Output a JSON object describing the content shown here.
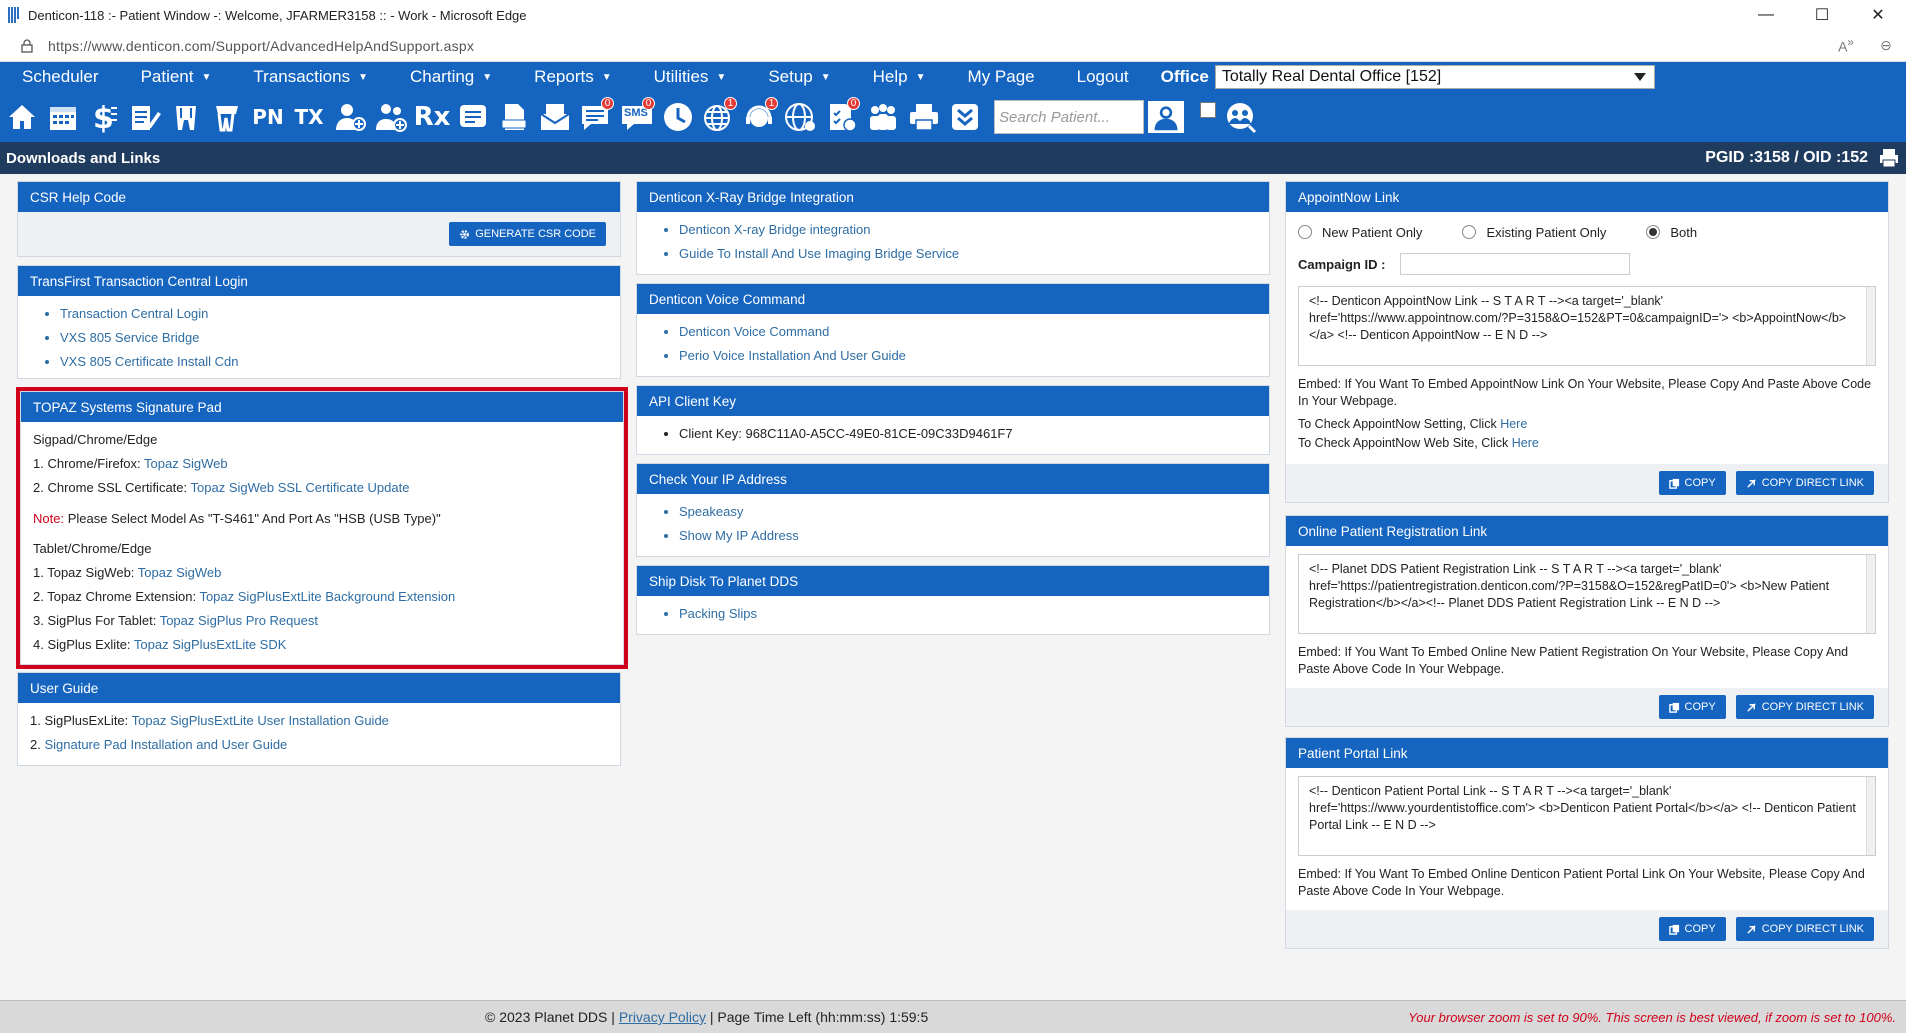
{
  "window": {
    "title": "Denticon-118 :- Patient Window -: Welcome, JFARMER3158 :: - Work - Microsoft Edge",
    "url": "https://www.denticon.com/Support/AdvancedHelpAndSupport.aspx"
  },
  "nav": {
    "items": [
      "Scheduler",
      "Patient",
      "Transactions",
      "Charting",
      "Reports",
      "Utilities",
      "Setup",
      "Help",
      "My Page",
      "Logout"
    ],
    "office_label": "Office",
    "office_value": "Totally Real Dental Office [152]"
  },
  "toolbar": {
    "pn_label": "PN",
    "tx_label": "TX",
    "rx_label": "Rx",
    "sms_label": "SMS",
    "badges": {
      "sms": "0",
      "globe": "1",
      "chat": "0",
      "help": "1",
      "doc": "0"
    },
    "search_placeholder": "Search Patient..."
  },
  "header": {
    "title": "Downloads and Links",
    "ids": "PGID :3158  /  OID :152"
  },
  "csr": {
    "title": "CSR Help Code",
    "button": "GENERATE CSR CODE"
  },
  "transfirst": {
    "title": "TransFirst Transaction Central Login",
    "links": [
      "Transaction Central Login",
      "VXS 805 Service Bridge",
      "VXS 805 Certificate Install Cdn"
    ]
  },
  "topaz": {
    "title": "TOPAZ Systems Signature Pad",
    "section1": "Sigpad/Chrome/Edge",
    "l1_label": "1. Chrome/Firefox: ",
    "l1_link": "Topaz SigWeb",
    "l2_label": "2. Chrome SSL Certificate: ",
    "l2_link": "Topaz SigWeb SSL Certificate Update",
    "note_label": "Note:",
    "note_text": " Please Select Model As \"T-S461\" And Port As \"HSB (USB Type)\"",
    "section2": "Tablet/Chrome/Edge",
    "t1_label": "1. Topaz SigWeb: ",
    "t1_link": "Topaz SigWeb",
    "t2_label": "2. Topaz Chrome Extension: ",
    "t2_link": "Topaz SigPlusExtLite Background Extension",
    "t3_label": "3. SigPlus For Tablet: ",
    "t3_link": "Topaz SigPlus Pro Request",
    "t4_label": "4. SigPlus Exlite: ",
    "t4_link": "Topaz SigPlusExtLite SDK"
  },
  "userguide": {
    "title": "User Guide",
    "g1_label": "1. SigPlusExLite: ",
    "g1_link": "Topaz SigPlusExtLite User Installation Guide",
    "g2_label": "2. ",
    "g2_link": "Signature Pad Installation and User Guide"
  },
  "xray": {
    "title": "Denticon X-Ray Bridge Integration",
    "links": [
      "Denticon X-ray Bridge integration",
      "Guide To Install And Use Imaging Bridge Service"
    ]
  },
  "voice": {
    "title": "Denticon Voice Command",
    "links": [
      "Denticon Voice Command",
      "Perio Voice Installation And User Guide"
    ]
  },
  "api": {
    "title": "API Client Key",
    "item": "Client Key: 968C11A0-A5CC-49E0-81CE-09C33D9461F7"
  },
  "ip": {
    "title": "Check Your IP Address",
    "links": [
      "Speakeasy",
      "Show My IP Address"
    ]
  },
  "ship": {
    "title": "Ship Disk To Planet DDS",
    "links": [
      "Packing Slips"
    ]
  },
  "appointnow": {
    "title": "AppointNow Link",
    "radios": [
      "New Patient Only",
      "Existing Patient Only",
      "Both"
    ],
    "selected": "Both",
    "campaign_label": "Campaign ID :",
    "code": "<!-- Denticon AppointNow Link --  S T A R T --><a target='_blank' href='https://www.appointnow.com/?P=3158&O=152&PT=0&campaignID='> <b>AppointNow</b></a> <!-- Denticon AppointNow --  E N D -->",
    "embed": "Embed: If You Want To Embed AppointNow Link On Your Website, Please Copy And Paste Above Code In Your Webpage.",
    "check1": "To Check AppointNow Setting, Click ",
    "check2": "To Check AppointNow Web Site, Click ",
    "here": "Here",
    "copy": "COPY",
    "copy_direct": "COPY DIRECT LINK"
  },
  "registration": {
    "title": "Online Patient Registration Link",
    "code": "<!-- Planet DDS Patient Registration Link --  S T A R T --><a target='_blank' href='https://patientregistration.denticon.com/?P=3158&O=152&regPatID=0'> <b>New Patient Registration</b></a><!-- Planet DDS Patient Registration Link --  E N D -->",
    "embed": "Embed: If You Want To Embed Online New Patient Registration On Your Website, Please Copy And Paste Above Code In Your Webpage.",
    "copy": "COPY",
    "copy_direct": "COPY DIRECT LINK"
  },
  "portal": {
    "title": "Patient Portal Link",
    "code": "<!-- Denticon Patient Portal Link --  S T A R T --><a target='_blank' href='https://www.yourdentistoffice.com'> <b>Denticon Patient Portal</b></a> <!-- Denticon Patient Portal Link --  E N D -->",
    "embed": "Embed: If You Want To Embed Online Denticon Patient Portal Link On Your Website, Please Copy And Paste Above Code In Your Webpage.",
    "copy": "COPY",
    "copy_direct": "COPY DIRECT LINK"
  },
  "footer": {
    "copyright": "© 2023 Planet DDS | ",
    "privacy": "Privacy Policy",
    "time": " | Page Time Left (hh:mm:ss) 1:59:5",
    "zoom": "Your browser zoom is set to 90%. This screen is best viewed, if zoom is set to 100%."
  },
  "colors": {
    "brand": "#1565c0",
    "header": "#1f3b5e",
    "link": "#2e6da4",
    "alert": "#d0021b"
  }
}
